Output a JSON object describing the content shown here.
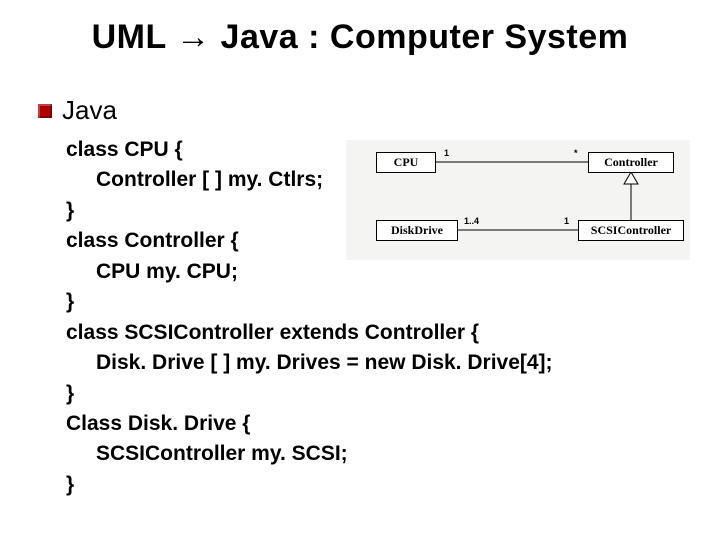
{
  "title": "UML → Java : Computer System",
  "bullet": "Java",
  "code": {
    "l1": "class CPU {",
    "l2": "Controller [ ] my. Ctlrs;",
    "l3": "}",
    "l4": "class Controller {",
    "l5": "CPU my. CPU;",
    "l6": "}",
    "l7": "class SCSIController extends Controller {",
    "l8": "Disk. Drive [ ] my. Drives = new Disk. Drive[4];",
    "l9": "}",
    "l10": "Class Disk. Drive {",
    "l11": "SCSIController my. SCSI;",
    "l12": "}"
  },
  "uml": {
    "cpu": "CPU",
    "controller": "Controller",
    "diskdrive": "DiskDrive",
    "scsicontroller": "SCSIController",
    "mult_1a": "1",
    "mult_star": "*",
    "mult_1b": "1",
    "mult_14": "1..4"
  }
}
